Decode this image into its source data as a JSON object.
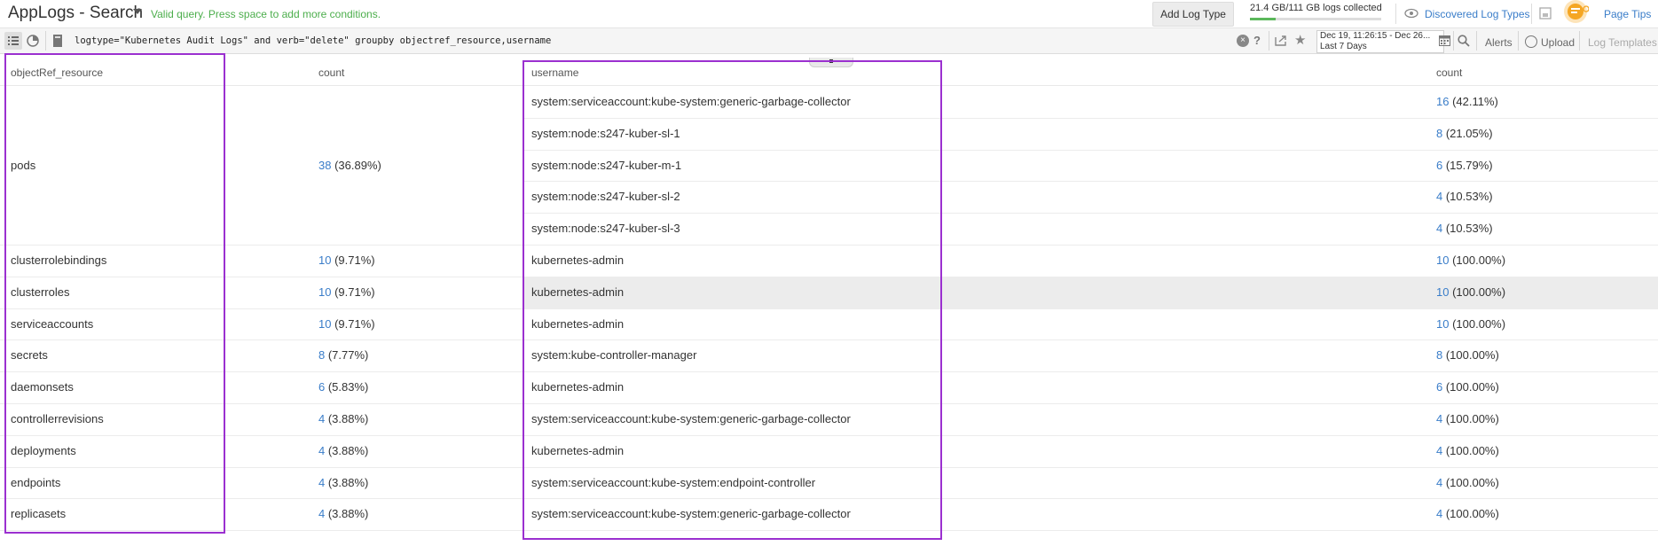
{
  "header": {
    "app_title": "AppLogs - Search",
    "valid_message": "Valid query. Press space to add more conditions.",
    "add_log_type": "Add Log Type",
    "storage_text": "21.4 GB/111 GB logs collected",
    "storage_fraction": 0.193,
    "discovered_log_types": "Discovered Log Types",
    "page_tips": "Page Tips"
  },
  "querybar": {
    "query": "logtype=\"Kubernetes Audit Logs\" and verb=\"delete\" groupby objectref_resource,username",
    "help": "?",
    "clear": "×",
    "star": "★",
    "date_range_top": "Dec 19, 11:26:15 - Dec 26...",
    "date_range_bottom": "Last 7 Days",
    "alerts": "Alerts",
    "upload": "Upload",
    "log_templates": "Log Templates"
  },
  "table": {
    "columns": [
      "objectRef_resource",
      "count",
      "username",
      "count"
    ],
    "groups": [
      {
        "resource": "pods",
        "count": "38",
        "pct": "(36.89%)"
      },
      {
        "resource": "clusterrolebindings",
        "count": "10",
        "pct": "(9.71%)"
      },
      {
        "resource": "clusterroles",
        "count": "10",
        "pct": "(9.71%)"
      },
      {
        "resource": "serviceaccounts",
        "count": "10",
        "pct": "(9.71%)"
      },
      {
        "resource": "secrets",
        "count": "8",
        "pct": "(7.77%)"
      },
      {
        "resource": "daemonsets",
        "count": "6",
        "pct": "(5.83%)"
      },
      {
        "resource": "controllerrevisions",
        "count": "4",
        "pct": "(3.88%)"
      },
      {
        "resource": "deployments",
        "count": "4",
        "pct": "(3.88%)"
      },
      {
        "resource": "endpoints",
        "count": "4",
        "pct": "(3.88%)"
      },
      {
        "resource": "replicasets",
        "count": "4",
        "pct": "(3.88%)"
      }
    ],
    "users": [
      {
        "username": "system:serviceaccount:kube-system:generic-garbage-collector",
        "count": "16",
        "pct": "(42.11%)"
      },
      {
        "username": "system:node:s247-kuber-sl-1",
        "count": "8",
        "pct": "(21.05%)"
      },
      {
        "username": "system:node:s247-kuber-m-1",
        "count": "6",
        "pct": "(15.79%)"
      },
      {
        "username": "system:node:s247-kuber-sl-2",
        "count": "4",
        "pct": "(10.53%)"
      },
      {
        "username": "system:node:s247-kuber-sl-3",
        "count": "4",
        "pct": "(10.53%)"
      },
      {
        "username": "kubernetes-admin",
        "count": "10",
        "pct": "(100.00%)"
      },
      {
        "username": "kubernetes-admin",
        "count": "10",
        "pct": "(100.00%)"
      },
      {
        "username": "kubernetes-admin",
        "count": "10",
        "pct": "(100.00%)"
      },
      {
        "username": "system:kube-controller-manager",
        "count": "8",
        "pct": "(100.00%)"
      },
      {
        "username": "kubernetes-admin",
        "count": "6",
        "pct": "(100.00%)"
      },
      {
        "username": "system:serviceaccount:kube-system:generic-garbage-collector",
        "count": "4",
        "pct": "(100.00%)"
      },
      {
        "username": "kubernetes-admin",
        "count": "4",
        "pct": "(100.00%)"
      },
      {
        "username": "system:serviceaccount:kube-system:endpoint-controller",
        "count": "4",
        "pct": "(100.00%)"
      },
      {
        "username": "system:serviceaccount:kube-system:generic-garbage-collector",
        "count": "4",
        "pct": "(100.00%)"
      }
    ]
  },
  "colors": {
    "accent": "#3a7dc9",
    "valid": "#4cae4c",
    "selection": "#9b30d0",
    "tips": "#f5a623"
  }
}
